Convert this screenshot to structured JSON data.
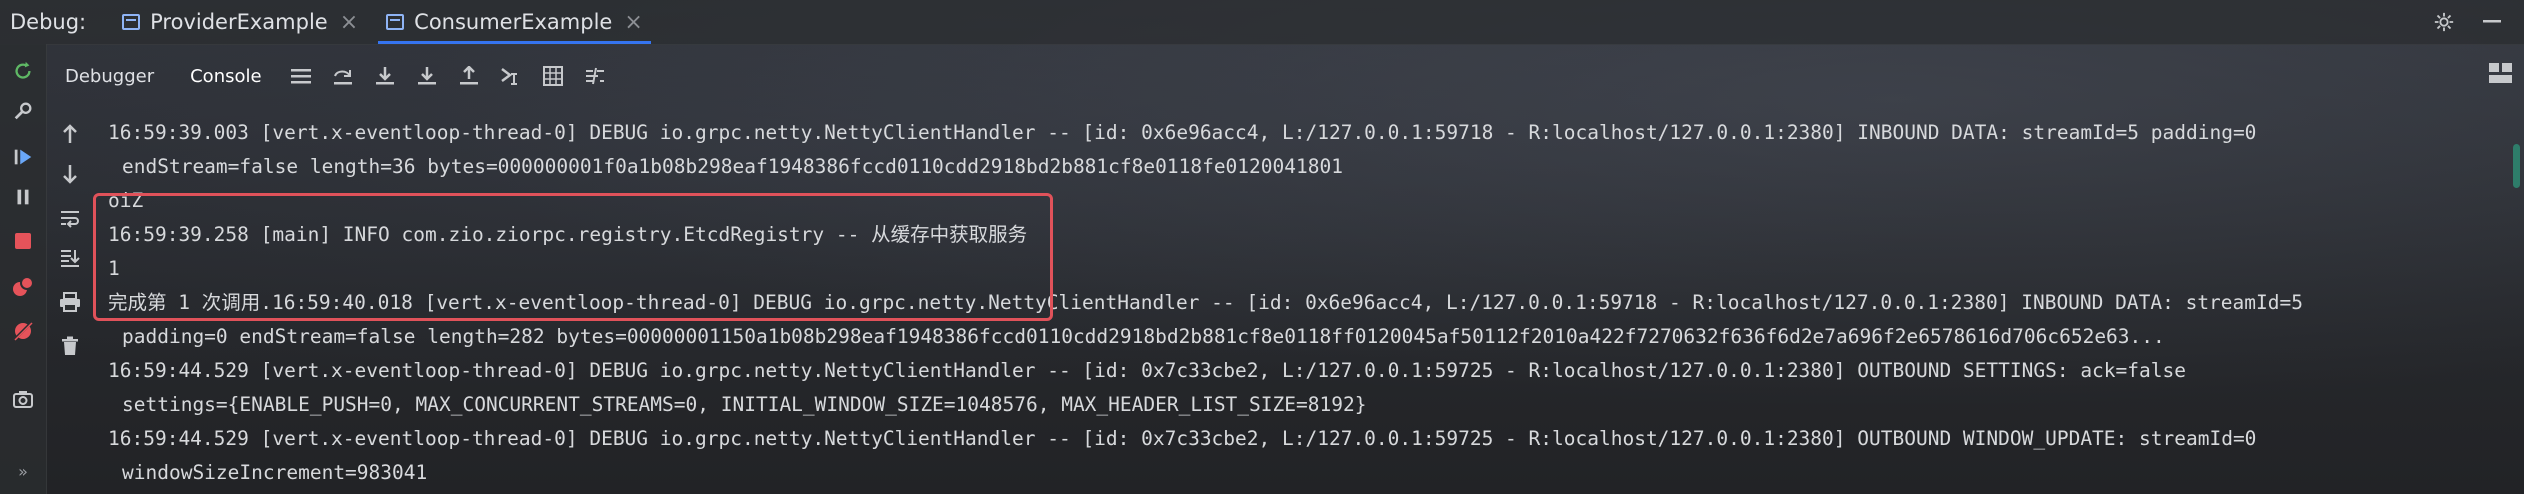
{
  "topbar": {
    "debug_label": "Debug:",
    "tabs": [
      {
        "label": "ProviderExample",
        "close": "×"
      },
      {
        "label": "ConsumerExample",
        "close": "×"
      }
    ],
    "icons": [
      "gear-icon",
      "minimize-icon"
    ]
  },
  "toolbar2": {
    "debugger_label": "Debugger",
    "console_label": "Console",
    "icons": [
      "menu-icon",
      "step-over-icon",
      "step-into-icon",
      "force-step-into-icon",
      "step-out-icon",
      "run-to-cursor-icon",
      "evaluate-icon",
      "trace-icon"
    ]
  },
  "gutter": {
    "icons": [
      "rerun-icon",
      "settings-wrench-icon",
      "resume-icon",
      "pause-icon",
      "stop-icon",
      "view-breakpoints-icon",
      "mute-breakpoints-icon",
      "camera-icon",
      "more-icon"
    ]
  },
  "console_gutter": {
    "icons": [
      "up-arrow-icon",
      "down-arrow-icon",
      "soft-wrap-icon",
      "scroll-to-end-icon",
      "print-icon",
      "trash-icon"
    ]
  },
  "console": {
    "lines": [
      "16:59:39.003 [vert.x-eventloop-thread-0] DEBUG io.grpc.netty.NettyClientHandler -- [id: 0x6e96acc4, L:/127.0.0.1:59718 - R:localhost/127.0.0.1:2380] INBOUND DATA: streamId=5 padding=0",
      "endStream=false length=36 bytes=000000001f0a1b08b298eaf1948386fccd0110cdd2918bd2b881cf8e0118fe0120041801",
      "oiZ",
      "16:59:39.258 [main] INFO com.zio.ziorpc.registry.EtcdRegistry -- 从缓存中获取服务",
      "1",
      "完成第 1 次调用.16:59:40.018 [vert.x-eventloop-thread-0] DEBUG io.grpc.netty.NettyClientHandler -- [id: 0x6e96acc4, L:/127.0.0.1:59718 - R:localhost/127.0.0.1:2380] INBOUND DATA: streamId=5",
      "padding=0 endStream=false length=282 bytes=00000001150a1b08b298eaf1948386fccd0110cdd2918bd2b881cf8e0118ff0120045af50112f2010a422f7270632f636f6d2e7a696f2e6578616d706c652e63...",
      "16:59:44.529 [vert.x-eventloop-thread-0] DEBUG io.grpc.netty.NettyClientHandler -- [id: 0x7c33cbe2, L:/127.0.0.1:59725 - R:localhost/127.0.0.1:2380] OUTBOUND SETTINGS: ack=false",
      "settings={ENABLE_PUSH=0, MAX_CONCURRENT_STREAMS=0, INITIAL_WINDOW_SIZE=1048576, MAX_HEADER_LIST_SIZE=8192}",
      "16:59:44.529 [vert.x-eventloop-thread-0] DEBUG io.grpc.netty.NettyClientHandler -- [id: 0x7c33cbe2, L:/127.0.0.1:59725 - R:localhost/127.0.0.1:2380] OUTBOUND WINDOW_UPDATE: streamId=0",
      "windowSizeIncrement=983041"
    ]
  },
  "colors": {
    "highlight_border": "#e0525a",
    "tab_underline": "#3574f0",
    "rerun_green": "#5fb865",
    "stop_red": "#e5535a"
  }
}
